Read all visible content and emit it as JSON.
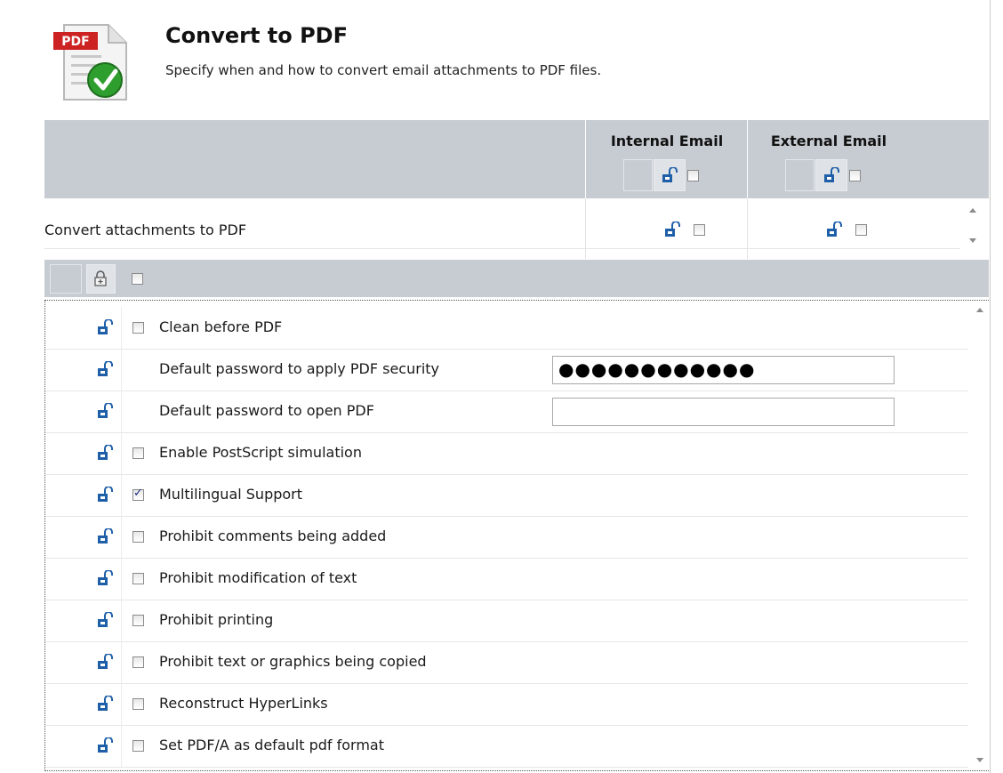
{
  "header": {
    "title": "Convert to PDF",
    "subtitle": "Specify when and how to convert email attachments to PDF files.",
    "icon_badge": "PDF"
  },
  "columns": {
    "internal": "Internal Email",
    "external": "External Email"
  },
  "convert_row": {
    "label": "Convert attachments to PDF",
    "internal_checked": false,
    "external_checked": false
  },
  "options": [
    {
      "label": "Clean before PDF",
      "type": "checkbox",
      "checked": false
    },
    {
      "label": "Default password to apply PDF security",
      "type": "password",
      "value": "●●●●●●●●●●●●"
    },
    {
      "label": "Default password to open PDF",
      "type": "password",
      "value": ""
    },
    {
      "label": "Enable PostScript simulation",
      "type": "checkbox",
      "checked": false
    },
    {
      "label": "Multilingual Support",
      "type": "checkbox",
      "checked": true
    },
    {
      "label": "Prohibit comments being added",
      "type": "checkbox",
      "checked": false
    },
    {
      "label": "Prohibit modification of text",
      "type": "checkbox",
      "checked": false
    },
    {
      "label": "Prohibit printing",
      "type": "checkbox",
      "checked": false
    },
    {
      "label": "Prohibit text or graphics being copied",
      "type": "checkbox",
      "checked": false
    },
    {
      "label": "Reconstruct HyperLinks",
      "type": "checkbox",
      "checked": false
    },
    {
      "label": "Set PDF/A as default pdf format",
      "type": "checkbox",
      "checked": false
    }
  ],
  "colors": {
    "header_bg": "#c7ccd2",
    "lock_blue": "#1f5fa8",
    "pdf_red": "#cc2222",
    "check_green": "#2e9e2e"
  }
}
